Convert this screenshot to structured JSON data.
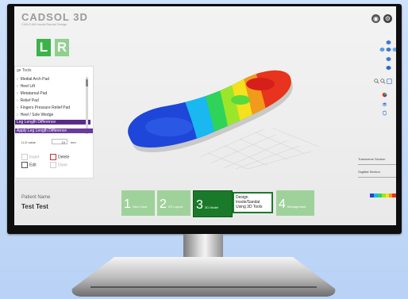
{
  "app": {
    "logo": "CADSOL 3D",
    "logo_sub": "CAD/CAM Insole/Sandal Design",
    "foot_left": "L",
    "foot_right": "R"
  },
  "colors": {
    "accent_green": "#1b7a2a",
    "step_green_light": "#9fd29a",
    "lr_left": "#3bb34a",
    "lr_right": "#8fd08e",
    "selected_purple": "#5a2a8a"
  },
  "panel": {
    "title": "ge Tools",
    "tools": [
      {
        "label": "Medial Arch Pad"
      },
      {
        "label": "Heel Lift"
      },
      {
        "label": "Metatarsal Pad"
      },
      {
        "label": "Relief Pad"
      },
      {
        "label": "Fingers Pressure Relief Pad"
      },
      {
        "label": "Heel / Sole Wedge"
      },
      {
        "label": "Leg Length Difference"
      }
    ],
    "apply_header": "Apply Leg Length Difference",
    "lld_label": "LLD value",
    "lld_value": "10",
    "lld_unit": "mm",
    "actions": {
      "insert": "Insert",
      "delete": "Delete",
      "edit": "Edit",
      "done": "Done"
    }
  },
  "right_panel": {
    "transverse_label": "Transverse Section",
    "sagittal_label": "Sagittal Section",
    "icons": [
      "view-cube-icon",
      "view-top-icon",
      "view-front-icon",
      "view-side-icon",
      "zoom-in-icon",
      "zoom-out-icon",
      "zoom-fit-icon",
      "color-map-icon",
      "layers-icon",
      "sync-icon"
    ]
  },
  "top_icons": [
    "camera-icon",
    "gear-icon"
  ],
  "patient": {
    "label": "Patient Name",
    "name": "Test Test"
  },
  "steps": [
    {
      "num": "1",
      "label": "New Case"
    },
    {
      "num": "2",
      "label": "2D Layout"
    },
    {
      "num": "3",
      "label": "3D Model",
      "active": true
    },
    {
      "num": "4",
      "label": "Management"
    }
  ],
  "step_callout": "Design Insole/Sandal Using 3D Tools"
}
